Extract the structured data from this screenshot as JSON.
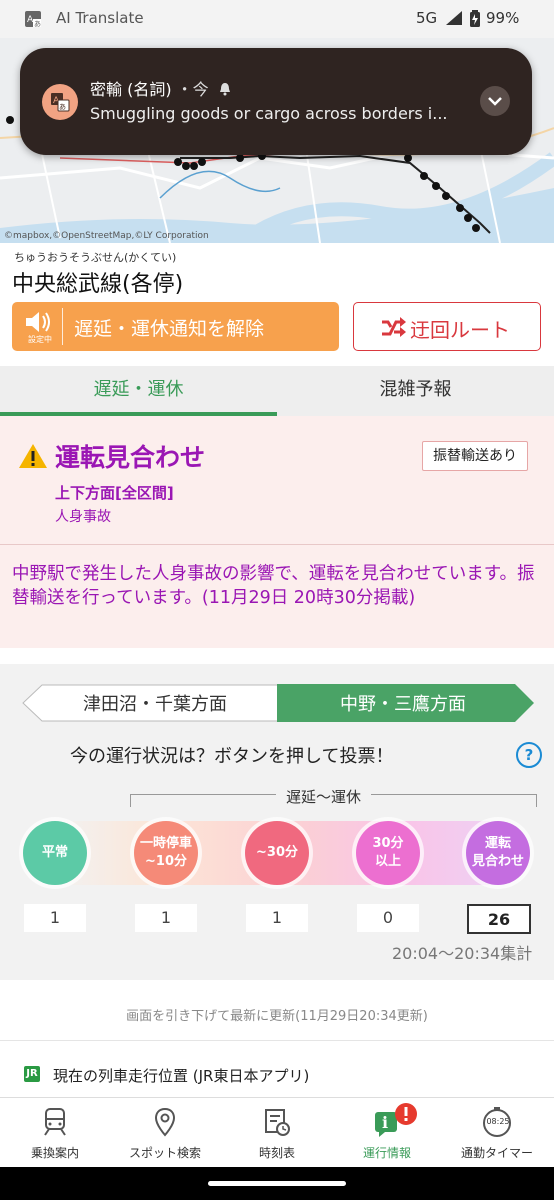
{
  "status_bar": {
    "app_title": "AI Translate",
    "network": "5G",
    "battery": "99%"
  },
  "map": {
    "attribution": "©mapbox,©OpenStreetMap,©LY Corporation"
  },
  "notification": {
    "title": "密輸 (名詞)",
    "time": "・今",
    "body": "Smuggling goods or cargo across borders i..."
  },
  "route": {
    "ruby": "ちゅうおうそうぶせん(かくてい)",
    "name": "中央総武線(各停)",
    "alert_button": {
      "label": "遅延・運休通知を解除",
      "caption": "設定中"
    },
    "detour_button": {
      "label": "迂回ルート"
    }
  },
  "tabs": [
    {
      "label": "遅延・運休",
      "active": true
    },
    {
      "label": "混雑予報",
      "active": false
    }
  ],
  "alert": {
    "status": "運転見合わせ",
    "badge": "振替輸送あり",
    "direction": "上下方面[全区間]",
    "cause": "人身事故",
    "message": "中野駅で発生した人身事故の影響で、運転を見合わせています。振替輸送を行っています。(11月29日 20時30分掲載)"
  },
  "vote": {
    "directions": [
      {
        "label": "津田沼・千葉方面",
        "active": false
      },
      {
        "label": "中野・三鷹方面",
        "active": true
      }
    ],
    "question": "今の運行状況は？ボタンを押して投票！",
    "help": "?",
    "range_label": "遅延〜運休",
    "options": [
      {
        "line1": "平常",
        "line2": "",
        "count": "1",
        "color": "#5ccaa6"
      },
      {
        "line1": "一時停車",
        "line2": "~10分",
        "count": "1",
        "color": "#f58a78"
      },
      {
        "line1": "~30分",
        "line2": "",
        "count": "1",
        "color": "#f0697f"
      },
      {
        "line1": "30分",
        "line2": "以上",
        "count": "0",
        "color": "#ec6fd0"
      },
      {
        "line1": "運転",
        "line2": "見合わせ",
        "count": "26",
        "color": "#c46de0",
        "selected": true
      }
    ],
    "period": "20:04〜20:34集計"
  },
  "refresh_note": "画面を引き下げて最新に更新(11月29日20:34更新)",
  "jr_link": {
    "logo": "JR",
    "label": "現在の列車走行位置 (JR東日本アプリ)"
  },
  "bottom_nav": [
    {
      "label": "乗換案内",
      "icon": "train-icon"
    },
    {
      "label": "スポット検索",
      "icon": "pin-icon"
    },
    {
      "label": "時刻表",
      "icon": "timetable-icon"
    },
    {
      "label": "運行情報",
      "icon": "info-icon",
      "active": true,
      "badge": "!"
    },
    {
      "label": "通勤タイマー",
      "icon": "timer-icon",
      "timer_text": "08:25"
    }
  ],
  "colors": {
    "accent_green": "#3a9b58",
    "alert_purple": "#9a16b4",
    "orange": "#f7a14d",
    "red": "#d9383e"
  }
}
